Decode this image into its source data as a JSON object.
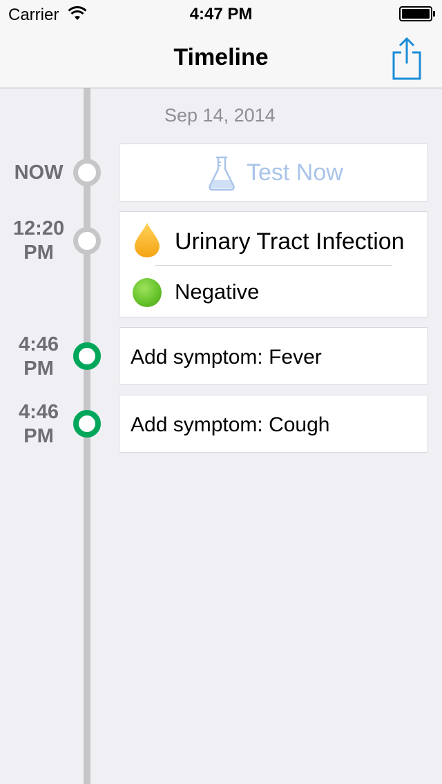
{
  "status_bar": {
    "carrier": "Carrier",
    "time": "4:47 PM"
  },
  "nav": {
    "title": "Timeline",
    "share_icon": "share-icon"
  },
  "timeline": {
    "date": "Sep 14, 2014",
    "entries": [
      {
        "time_line1": "NOW",
        "time_line2": "",
        "node_style": "grey",
        "type": "action",
        "label": "Test Now",
        "icon": "flask-icon"
      },
      {
        "time_line1": "12:20",
        "time_line2": "PM",
        "node_style": "grey",
        "type": "result",
        "test_name": "Urinary Tract Infection",
        "test_icon": "drop-icon",
        "result": "Negative",
        "result_icon": "green-dot-icon"
      },
      {
        "time_line1": "4:46",
        "time_line2": "PM",
        "node_style": "green",
        "type": "symptom",
        "label": "Add symptom: Fever"
      },
      {
        "time_line1": "4:46",
        "time_line2": "PM",
        "node_style": "green",
        "type": "symptom",
        "label": "Add symptom: Cough"
      }
    ]
  },
  "colors": {
    "background": "#efeff4",
    "accent_blue": "#1a8cd8",
    "test_now_text": "#a9c4ea",
    "node_grey": "#c6c6c9",
    "node_green": "#00a65a",
    "drop_orange": "#f8b11c",
    "result_green": "#66c42b"
  }
}
